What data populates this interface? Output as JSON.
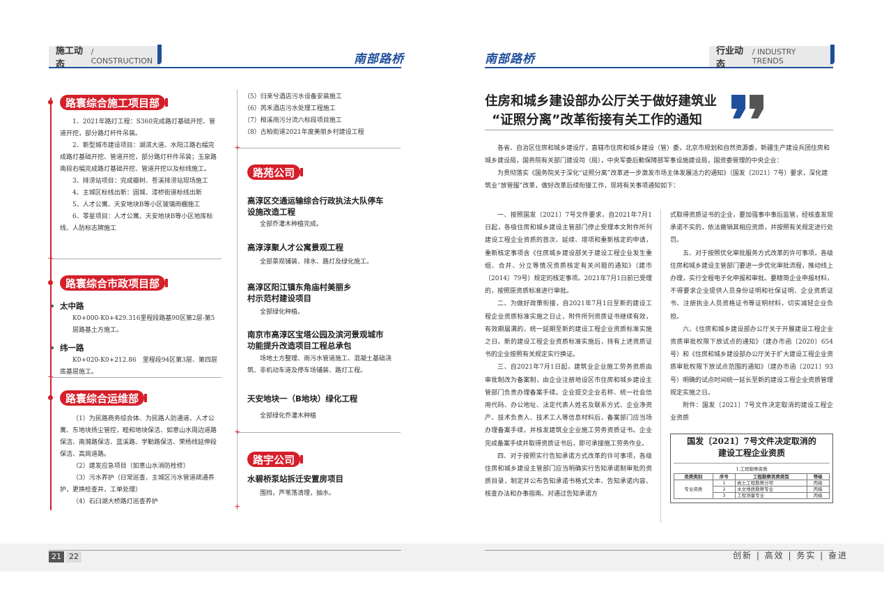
{
  "left_header": {
    "title": "施工动态",
    "subtitle": " / CONSTRUCTION",
    "brand": "南部路桥"
  },
  "right_header": {
    "title": "行业动态",
    "subtitle": " / INDUSTRY TRENDS",
    "brand": "南部路桥"
  },
  "sec1": {
    "title": "路寰综合施工项目部",
    "paras": [
      "1、2021年路灯工程：S360完成路灯基础开挖、管道开挖，部分路灯杆件吊装。",
      "2、新型城市建设项目：湖滨大道、水阳江路右幅完成路灯基础开挖、管道开挖，部分路灯杆件吊装；玉泉路南段右幅完成路灯基础开挖、管道开挖以及标线施工。",
      "3、排涝站项目：完成瓣树、苍溪排涝站现场施工",
      "4、主城区标线出新：固城、漆桥街道标线出新",
      "5、人才公寓、天安地块B等小区玻璃雨棚施工",
      "6、零星项目：人才公寓、天安地块B等小区地库标线、人防标志牌施工"
    ]
  },
  "sec2": {
    "title": "路寰综合市政项目部",
    "items": [
      {
        "name": "太中路",
        "desc": "K0+000-K0+429.316里程段路基90区第2层-第5层路基土方施工。"
      },
      {
        "name": "纬一路",
        "desc": "K0+020-K0+212.86　里程段94区第3层、第四层底基层施工。"
      }
    ]
  },
  "sec3": {
    "title": "路寰综合运维部",
    "paras": [
      "（1）为民路商务综合体、为民路人防通道、人才公寓、东地块扬尘管控，睦和地块保洁、如意山水周边道路保洁、南漪路保洁、蓝溪路、学勤路保洁、荣杨线延伸段保洁、高岗道路。",
      "（2）建发应急项目（如意山水消防栓修）",
      "（3）污水养护（日常巡查、主城区污水管道疏通养护，更换检查井，工单处理）",
      "（4）石臼湖大桥路灯巡查养护"
    ]
  },
  "col2_top": [
    "（5）归来兮酒店污水设备安装施工",
    "（6）芮禾酒店污水处理工程施工",
    "（7）桠溪雨污分流六标段项目施工",
    "（8）古柏街道2021年度美丽乡村建设工程"
  ],
  "sec4": {
    "title": "路苑公司",
    "projects": [
      {
        "title": "高淳区交通运输综合行政执法大队停车设施改造工程",
        "desc": "全部乔灌木种植完成。"
      },
      {
        "title": "高淳淳聚人才公寓景观工程",
        "desc": "全部景观铺装、排水、路灯及绿化施工。"
      },
      {
        "title": "高淳区阳江镇东角庙村美丽乡村示范村建设项目",
        "desc": "全部绿化种植。"
      },
      {
        "title": "南京市高淳区宝塔公园及滨河景观城市功能提升改造项目工程总承包",
        "desc": "场地土方整理、雨污水管道施工、混凝土基础浇筑、非机动车道及停车场铺装、路灯工程。"
      },
      {
        "title": "天安地块一（B地块）绿化工程",
        "desc": "全部绿化乔灌木种植"
      }
    ]
  },
  "sec5": {
    "title": "路宇公司",
    "project": {
      "title": "水碧桥泵站拆迁安置房项目",
      "desc": "围挡，芦苇荡清理，抽水。"
    }
  },
  "article": {
    "title_line1": "住房和城乡建设部办公厅关于做好建筑业",
    "title_line2": "“证照分离”改革衔接有关工作的通知",
    "intro": [
      "各省、自治区住房和城乡建设厅，直辖市住房和城乡建设（管）委，北京市规划和自然资源委，新疆生产建设兵团住房和城乡建设局，国务院有关部门建设司（局），中央军委后勤保障部军事设施建设局，国资委管理的中央企业：",
      "为贯彻落实《国务院关于深化“证照分离”改革进一步激发市场主体发展活力的通知》（国发〔2021〕7号）要求，深化建筑业“放管服”改革，做好改革后续衔接工作，现将有关事项通知如下："
    ],
    "col1": [
      "一、按照国发〔2021〕7号文件要求，自2021年7月1日起，各级住房和城乡建设主管部门停止受理本文附件所列建设工程企业资质的首次、延续、增项和重新核定的申请，重新核定事项含《住房城乡建设部关于建设工程企业发生重组、合并、分立等情况资质核定有关问题的通知》（建市〔2014〕79号）规定的核定事项。2021年7月1日前已受理的，按照原资质标准进行审批。",
      "二、为做好政策衔接，自2021年7月1日至新的建设工程企业资质标准实施之日止，附件所列资质证书继续有效，有效期届满的，统一延期至新的建设工程企业资质标准实施之日。新的建设工程企业资质标准实施后，持有上述资质证书的企业按照有关规定实行换证。",
      "三、自2021年7月1日起，建筑业企业施工劳务资质由审批制改为备案制，由企业注册地设区市住房和城乡建设主管部门负责办理备案手续。企业提交企业名称、统一社会信用代码、办公地址、法定代表人姓名及联系方式、企业净资产、技术负责人、技术工人等信息材料后，备案部门应当场办理备案手续，并核发建筑业企业施工劳务资质证书。企业完成备案手续并取得资质证书后，即可承接施工劳务作业。",
      "四、对于按照实行告知承诺方式改革的许可事项，各级住房和城乡建设主管部门应当明确实行告知承诺制审批的资质目录，制定并公布告知承诺书格式文本、告知承诺内容、核查办法和办事指南。对通过告知承诺方"
    ],
    "col2": [
      "式取得资质证书的企业，要加强事中事后监管，经核查发现承诺不实的，依法撤销其相应资质，并按照有关规定进行处罚。",
      "五、对于按照优化审批服务方式改革的许可事项，各级住房和城乡建设主管部门要进一步优化审批流程，推动线上办理，实行全程电子化申报和审批。要精简企业申报材料，不得要求企业提供人员身份证明和社保证明、企业资质证书、注册执业人员资格证书等证明材料，切实减轻企业负担。",
      "六、《住房和城乡建设部办公厅关于开展建设工程企业资质审批权限下放试点的通知》（建办市函〔2020〕654号）和《住房和城乡建设部办公厅关于扩大建设工程企业资质审批权限下放试点范围的通知》（建办市函〔2021〕93号）明确的试点时间统一延长至新的建设工程企业资质管理规定实施之日。",
      "附件：国发〔2021〕7号文件决定取消的建设工程企业资质"
    ],
    "doc_box": {
      "title_line1": "国发〔2021〕7号文件决定取消的",
      "title_line2": "建设工程企业资质",
      "subtitle": "1.工程勘察资质",
      "headers": [
        "资质类别",
        "序号",
        "工程勘察资质类型",
        "等级"
      ],
      "category": "专业资质",
      "rows": [
        {
          "no": "1",
          "type": "岩土工程勘察分项",
          "level": "丙级"
        },
        {
          "no": "2",
          "type": "水文地质勘察专业",
          "level": "丙级"
        },
        {
          "no": "3",
          "type": "工程测量专业",
          "level": "丙级"
        }
      ]
    }
  },
  "footer": {
    "page_left": "21",
    "page_right": "22",
    "slogan": "创新 | 高效 | 务实 | 奋进"
  },
  "colors": {
    "brand_blue": "#1f4e9b",
    "accent_red": "#d51f2a"
  }
}
